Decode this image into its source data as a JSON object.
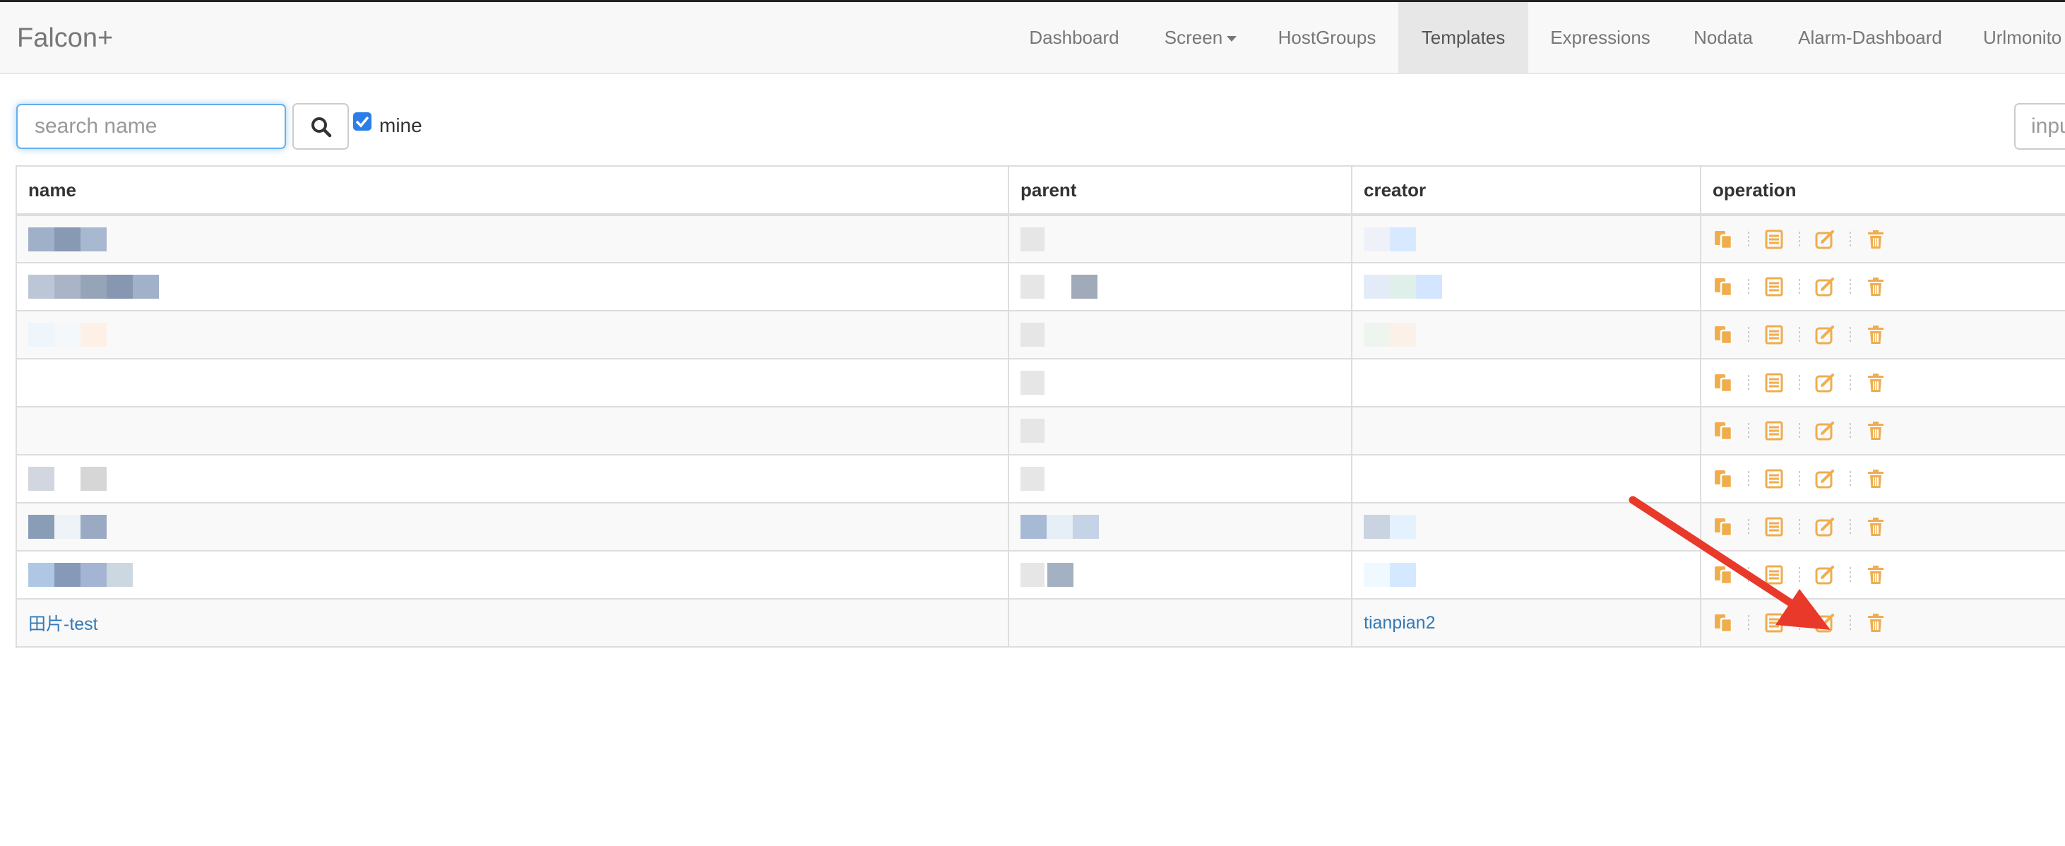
{
  "navbar": {
    "brand": "Falcon+",
    "items": [
      {
        "label": "Dashboard",
        "active": false
      },
      {
        "label": "Screen",
        "active": false,
        "dropdown": true
      },
      {
        "label": "HostGroups",
        "active": false
      },
      {
        "label": "Templates",
        "active": true
      },
      {
        "label": "Expressions",
        "active": false
      },
      {
        "label": "Nodata",
        "active": false
      },
      {
        "label": "Alarm-Dashboard",
        "active": false
      },
      {
        "label": "Urlmonito",
        "active": false
      }
    ]
  },
  "search": {
    "placeholder": "search name",
    "value": "",
    "mine_checked": true,
    "mine_label": "mine",
    "right_placeholder": "inpu"
  },
  "table": {
    "columns": [
      "name",
      "parent",
      "creator",
      "operation"
    ],
    "last_row": {
      "name": "田片-test",
      "parent": "",
      "creator": "tianpian2"
    }
  },
  "icons": {
    "search": "search-icon",
    "copy": "copy-icon",
    "list": "list-icon",
    "edit": "edit-icon",
    "delete": "trash-icon"
  },
  "colors": {
    "link": "#337ab7",
    "operation_icon": "#f0ad4e",
    "annotation_arrow": "#e8392a",
    "focus": "#66afe9"
  }
}
